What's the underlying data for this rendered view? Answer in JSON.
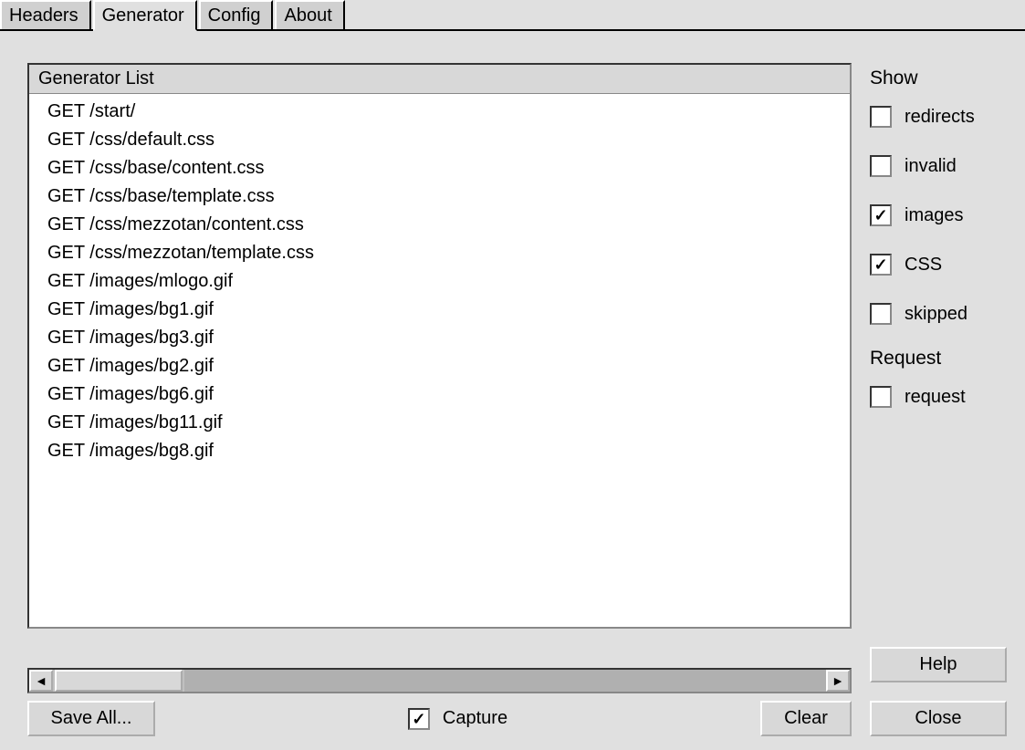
{
  "tabs": [
    {
      "label": "Headers"
    },
    {
      "label": "Generator"
    },
    {
      "label": "Config"
    },
    {
      "label": "About"
    }
  ],
  "activeTab": 1,
  "list": {
    "header": "Generator List",
    "items": [
      "GET /start/",
      "GET /css/default.css",
      "GET /css/base/content.css",
      "GET /css/base/template.css",
      "GET /css/mezzotan/content.css",
      "GET /css/mezzotan/template.css",
      "GET /images/mlogo.gif",
      "GET /images/bg1.gif",
      "GET /images/bg3.gif",
      "GET /images/bg2.gif",
      "GET /images/bg6.gif",
      "GET /images/bg11.gif",
      "GET /images/bg8.gif"
    ]
  },
  "sidebar": {
    "showTitle": "Show",
    "requestTitle": "Request",
    "options": [
      {
        "label": "redirects",
        "checked": false
      },
      {
        "label": "invalid",
        "checked": false
      },
      {
        "label": "images",
        "checked": true
      },
      {
        "label": "CSS",
        "checked": true
      },
      {
        "label": "skipped",
        "checked": false
      }
    ],
    "requestOptions": [
      {
        "label": "request",
        "checked": false
      }
    ]
  },
  "buttons": {
    "saveAll": "Save All...",
    "capture": "Capture",
    "clear": "Clear",
    "help": "Help",
    "close": "Close"
  },
  "captureChecked": true,
  "icons": {
    "left": "◄",
    "right": "►",
    "check": "✓"
  }
}
